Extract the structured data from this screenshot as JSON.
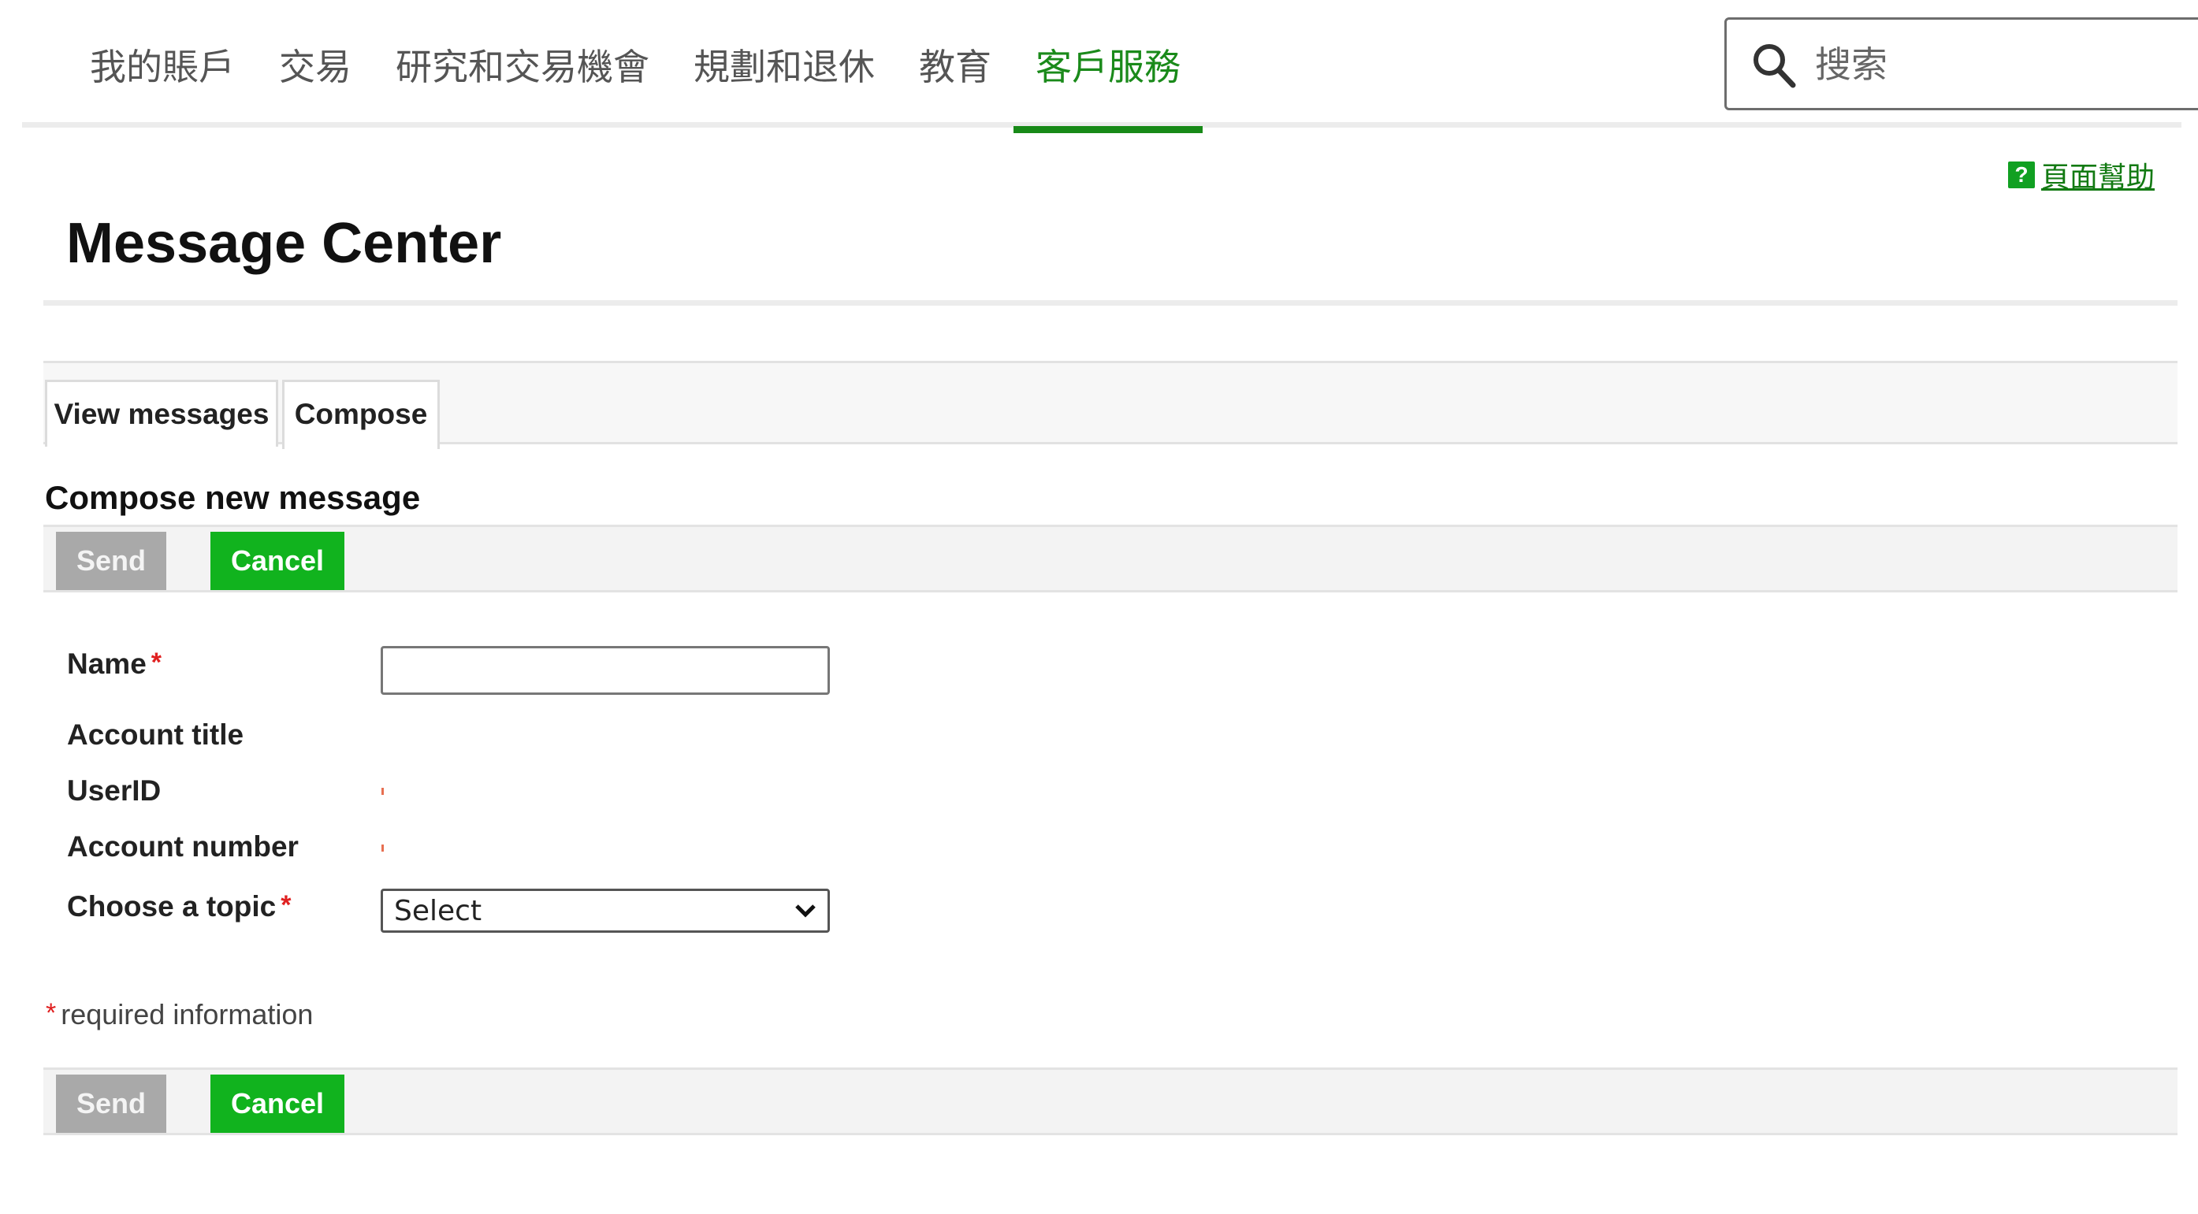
{
  "nav": {
    "items": [
      {
        "label": "我的賬戶",
        "active": false
      },
      {
        "label": "交易",
        "active": false
      },
      {
        "label": "研究和交易機會",
        "active": false
      },
      {
        "label": "規劃和退休",
        "active": false
      },
      {
        "label": "教育",
        "active": false
      },
      {
        "label": "客戶服務",
        "active": true
      }
    ],
    "search": {
      "placeholder": "搜索",
      "icon": "search-icon"
    }
  },
  "help": {
    "label": "頁面幫助",
    "icon_glyph": "?"
  },
  "page": {
    "title": "Message Center"
  },
  "tabs": [
    {
      "label": "View messages",
      "active": false
    },
    {
      "label": "Compose",
      "active": true
    }
  ],
  "compose": {
    "title": "Compose new message",
    "send_label": "Send",
    "cancel_label": "Cancel",
    "required_star": "*",
    "required_note": "required information",
    "fields": {
      "name_label": "Name",
      "name_value": "",
      "account_title_label": "Account title",
      "userid_label": "UserID",
      "account_number_label": "Account number",
      "topic_label": "Choose a topic",
      "topic_value": "Select"
    }
  },
  "colors": {
    "accent": "#1a8a1a",
    "cancel_button": "#11b31e",
    "send_button_disabled": "#a9a9a9",
    "required": "#e02020"
  }
}
